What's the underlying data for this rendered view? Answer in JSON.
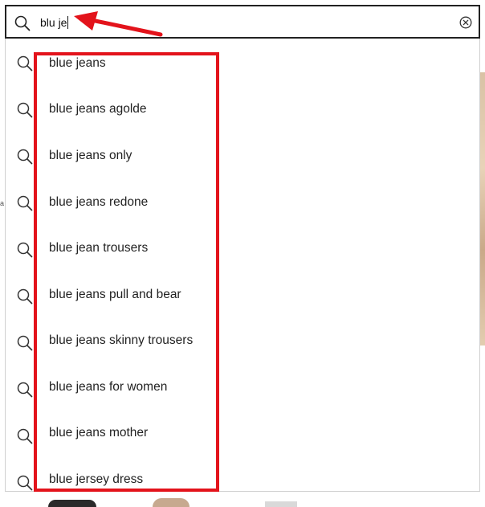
{
  "search": {
    "query": "blu je",
    "search_icon": "search-icon",
    "clear_icon": "clear-circle-x-icon"
  },
  "suggestions": [
    {
      "label": "blue jeans",
      "icon": "search-icon"
    },
    {
      "label": "blue jeans agolde",
      "icon": "search-icon"
    },
    {
      "label": "blue jeans only",
      "icon": "search-icon"
    },
    {
      "label": "blue jeans redone",
      "icon": "search-icon"
    },
    {
      "label": "blue jean trousers",
      "icon": "search-icon"
    },
    {
      "label": "blue jeans pull and bear",
      "icon": "search-icon"
    },
    {
      "label": "blue jeans skinny trousers",
      "icon": "search-icon"
    },
    {
      "label": "blue jeans for women",
      "icon": "search-icon"
    },
    {
      "label": "blue jeans mother",
      "icon": "search-icon"
    },
    {
      "label": "blue jersey dress",
      "icon": "search-icon"
    }
  ],
  "annotations": {
    "highlight_color": "#e3131b",
    "arrow_icon": "red-arrow-icon"
  },
  "background": {
    "edge_letter": "a"
  }
}
